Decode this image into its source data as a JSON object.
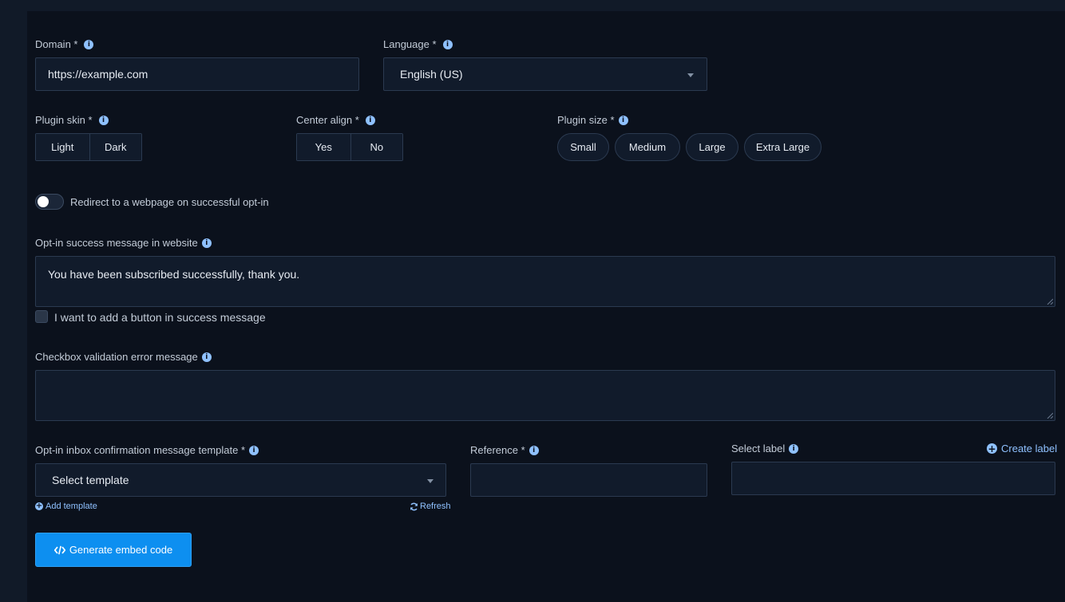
{
  "domain": {
    "label": "Domain *",
    "value": "https://example.com"
  },
  "language": {
    "label": "Language *",
    "selected": "English (US)"
  },
  "plugin_skin": {
    "label": "Plugin skin *",
    "options": [
      "Light",
      "Dark"
    ]
  },
  "center_align": {
    "label": "Center align *",
    "options": [
      "Yes",
      "No"
    ]
  },
  "plugin_size": {
    "label": "Plugin size *",
    "options": [
      "Small",
      "Medium",
      "Large",
      "Extra Large"
    ]
  },
  "redirect": {
    "label": "Redirect to a webpage on successful opt-in"
  },
  "success_message": {
    "label": "Opt-in success message in website",
    "value": "You have been subscribed successfully, thank you."
  },
  "add_button": {
    "label": "I want to add a button in success message"
  },
  "checkbox_error": {
    "label": "Checkbox validation error message",
    "value": ""
  },
  "template": {
    "label": "Opt-in inbox confirmation message template *",
    "placeholder": "Select template",
    "add_link": "Add template",
    "refresh_link": "Refresh"
  },
  "reference": {
    "label": "Reference *",
    "value": ""
  },
  "select_label": {
    "label": "Select label",
    "create_link": "Create label",
    "value": ""
  },
  "generate_button": {
    "label": "Generate embed code"
  },
  "colors": {
    "accent": "#0d8ff0",
    "info": "#8fc1ff",
    "background": "#0b111c"
  }
}
